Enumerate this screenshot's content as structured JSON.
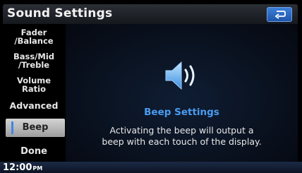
{
  "window": {
    "title": "Sound Settings"
  },
  "header": {
    "back_icon": "return-arrow-icon",
    "accent_color": "#2e6ac4"
  },
  "sidebar": {
    "items": [
      {
        "line1": "Fader",
        "line2": "/Balance"
      },
      {
        "line1": "Bass/Mid",
        "line2": "/Treble"
      },
      {
        "line1": "Volume",
        "line2": "Ratio"
      },
      {
        "line1": "Advanced",
        "line2": ""
      }
    ],
    "selected": {
      "label": "Beep"
    },
    "done_label": "Done"
  },
  "main": {
    "icon": "speaker-volume-icon",
    "heading": "Beep Settings",
    "description_line1": "Activating the beep will output a",
    "description_line2": "beep with each touch of the display.",
    "heading_color": "#4a9cf0"
  },
  "status": {
    "time": "12:00",
    "ampm": "PM"
  }
}
